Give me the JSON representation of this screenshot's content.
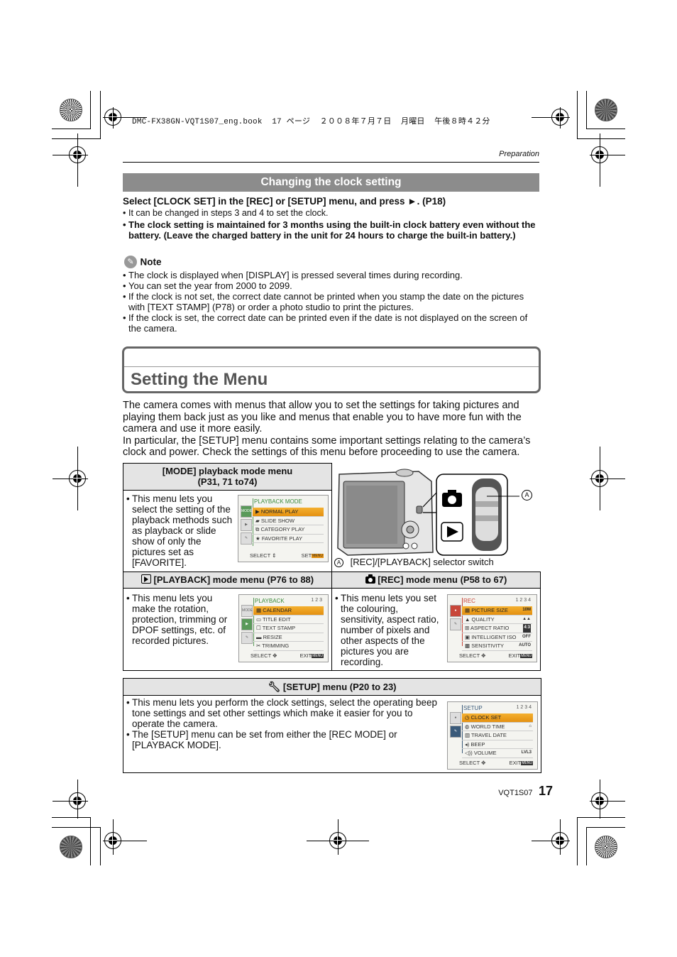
{
  "print_header": {
    "line": "DMC-FX38GN-VQT1S07_eng.book  17 ページ  ２００８年７月７日  月曜日  午後８時４２分"
  },
  "section_label": "Preparation",
  "clock": {
    "heading": "Changing the clock setting",
    "instruction": "Select [CLOCK SET] in the [REC] or [SETUP] menu, and press ►. (P18)",
    "bullets": [
      "It can be changed in steps 3 and 4 to set the clock.",
      "The clock setting is maintained for 3 months using the built-in clock battery even without the battery. (Leave the charged battery in the unit for 24 hours to charge the built-in battery.)"
    ],
    "note_label": "Note",
    "notes": [
      "The clock is displayed when [DISPLAY] is pressed several times during recording.",
      "You can set the year from 2000 to 2099.",
      "If the clock is not set, the correct date cannot be printed when you stamp the date on the pictures with [TEXT STAMP] (P78) or order a photo studio to print the pictures.",
      "If the clock is set, the correct date can be printed even if the date is not displayed on the screen of the camera."
    ]
  },
  "menu_section": {
    "title": "Setting the Menu",
    "intro_1": "The camera comes with menus that allow you to set the settings for taking pictures and playing them back just as you like and menus that enable you to have more fun with the camera and use it more easily.",
    "intro_2": "In particular, the [SETUP] menu contains some important settings relating to the camera’s clock and power. Check the settings of this menu before proceeding to use the camera."
  },
  "mode_menu": {
    "header_line1": "[MODE] playback mode menu",
    "header_line2": "(P31, 71 to74)",
    "description": "This menu lets you select the setting of the playback methods such as playback or slide show of only the pictures set as [FAVORITE].",
    "screen": {
      "title": "PLAYBACK MODE",
      "tabs": [
        "MODE",
        "▶",
        "✎"
      ],
      "items": [
        "NORMAL PLAY",
        "SLIDE SHOW",
        "CATEGORY PLAY",
        "FAVORITE PLAY"
      ],
      "item_icons": [
        "▶",
        "▰",
        "⧉",
        "★"
      ],
      "selected_index": 0,
      "footer_left": "SELECT",
      "footer_right": "SET"
    }
  },
  "selector_switch": {
    "callout": "A",
    "caption": "[REC]/[PLAYBACK] selector switch"
  },
  "playback_menu": {
    "header": "[PLAYBACK] mode menu (P76 to 88)",
    "description": "This menu lets you make the rotation, protection, trimming or DPOF settings, etc. of recorded pictures.",
    "screen": {
      "title": "PLAYBACK",
      "page": "1 2 3",
      "tabs": [
        "MODE",
        "▶",
        "✎"
      ],
      "items": [
        "CALENDAR",
        "TITLE EDIT",
        "TEXT STAMP",
        "RESIZE",
        "TRIMMING"
      ],
      "item_icons": [
        "▦",
        "▭",
        "☐",
        "▬",
        "✂"
      ],
      "selected_index": 0,
      "footer_left": "SELECT",
      "footer_right": "EXIT"
    }
  },
  "rec_menu": {
    "header": "[REC] mode menu (P58 to 67)",
    "description": "This menu lets you set the colouring, sensitivity, aspect ratio, number of pixels and other aspects of the pictures you are recording.",
    "screen": {
      "title": "REC",
      "page": "1 2 3 4",
      "tabs": [
        "●",
        "✎"
      ],
      "items": [
        "PICTURE SIZE",
        "QUALITY",
        "ASPECT RATIO",
        "INTELLIGENT ISO",
        "SENSITIVITY"
      ],
      "values": [
        "10M",
        "▲▲",
        "4:3",
        "OFF",
        "AUTO"
      ],
      "item_icons": [
        "▦",
        "▲",
        "⊞",
        "▣",
        "▩"
      ],
      "selected_index": 0,
      "footer_left": "SELECT",
      "footer_right": "EXIT"
    }
  },
  "setup_menu": {
    "header": "[SETUP] menu (P20 to 23)",
    "descriptions": [
      "This menu lets you perform the clock settings, select the operating beep tone settings and set other settings which make it easier for you to operate the camera.",
      "The [SETUP] menu can be set from either the [REC MODE] or [PLAYBACK MODE]."
    ],
    "screen": {
      "title": "SETUP",
      "page": "1 2 3 4",
      "tabs": [
        "●",
        "✎"
      ],
      "items": [
        "CLOCK SET",
        "WORLD TIME",
        "TRAVEL DATE",
        "BEEP",
        "VOLUME"
      ],
      "values": [
        "",
        "⌂",
        "",
        "",
        "LVL3"
      ],
      "item_icons": [
        "◷",
        "◍",
        "▥",
        "◂)",
        "◁))"
      ],
      "selected_index": 0,
      "footer_left": "SELECT",
      "footer_right": "EXIT"
    }
  },
  "footer": {
    "code": "VQT1S07",
    "page_number": "17"
  }
}
